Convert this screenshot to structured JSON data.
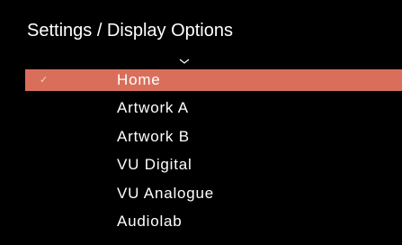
{
  "header": {
    "title": "Settings / Display Options"
  },
  "icons": {
    "scroll_up": "chevron-up-icon",
    "selected_marker": "checkmark-icon"
  },
  "colors": {
    "background": "#000000",
    "selection": "#d96f5b",
    "text": "#ffffff"
  },
  "menu": {
    "selected_index": 0,
    "check_glyph": "✓",
    "items": [
      {
        "label": "Home"
      },
      {
        "label": "Artwork A"
      },
      {
        "label": "Artwork B"
      },
      {
        "label": "VU Digital"
      },
      {
        "label": "VU Analogue"
      },
      {
        "label": "Audiolab"
      }
    ]
  }
}
